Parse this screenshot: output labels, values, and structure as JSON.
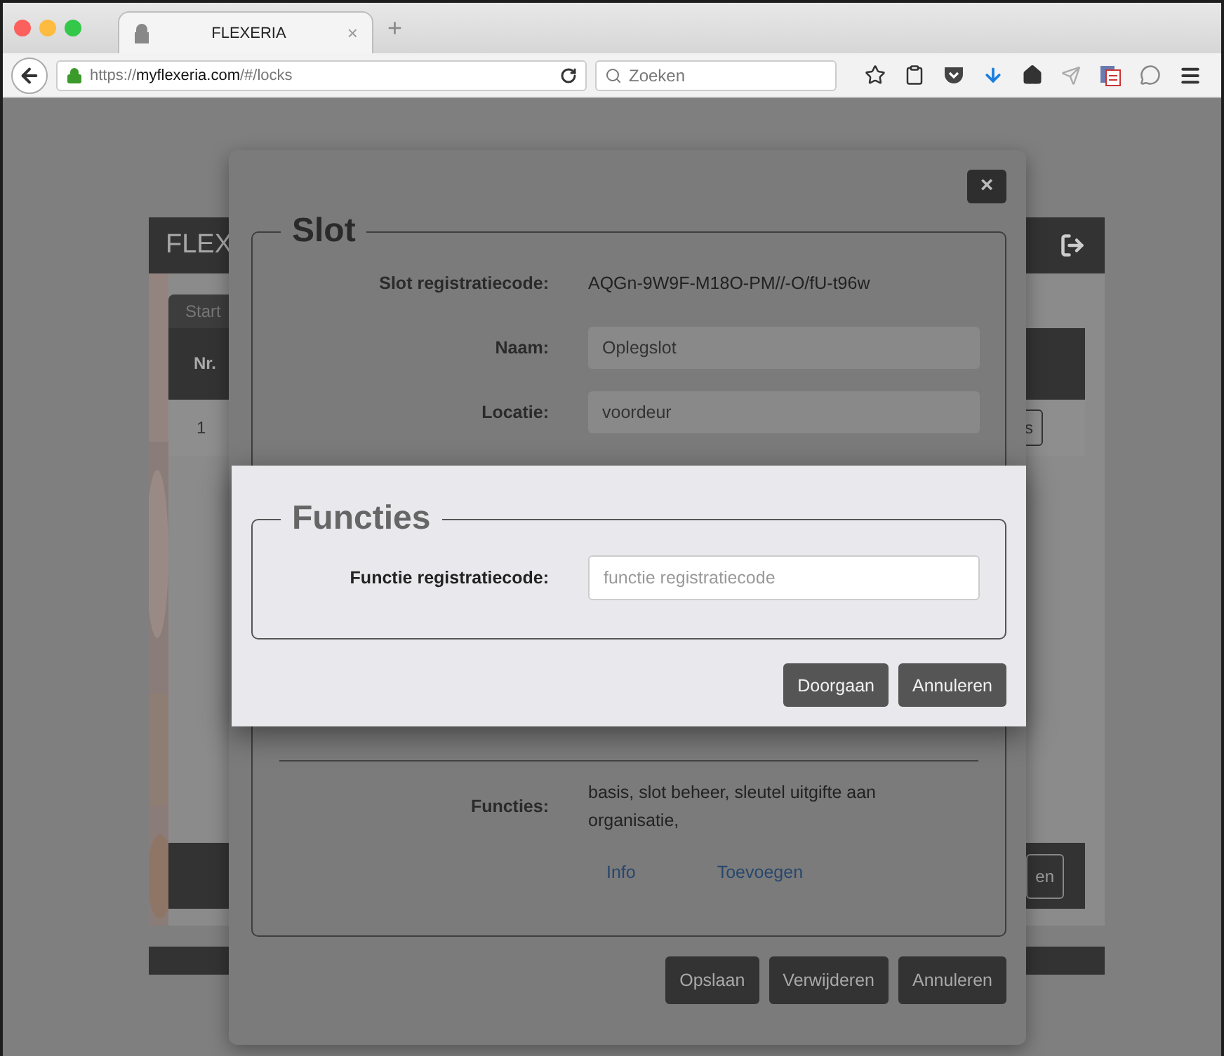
{
  "browser": {
    "tab": {
      "title": "FLEXERIA",
      "close": "×"
    },
    "new_tab": "+",
    "url": {
      "scheme": "https://",
      "host": "myflexeria.com",
      "path": "/#/locks"
    },
    "search": {
      "placeholder": "Zoeken"
    }
  },
  "background_app": {
    "brand": "FLEX",
    "tab": "Start",
    "column": "Nr.",
    "row_number": "1",
    "row_button": "s",
    "footer_button": "en"
  },
  "slot_dialog": {
    "close": "×",
    "legend": "Slot",
    "fields": [
      {
        "kind": "text",
        "label": "Slot registratiecode:",
        "value": "AQGn-9W9F-M18O-PM//-O/fU-t96w"
      },
      {
        "kind": "input",
        "label": "Naam:",
        "value": "Oplegslot"
      },
      {
        "kind": "input",
        "label": "Locatie:",
        "value": "voordeur"
      }
    ],
    "functies": {
      "label": "Functies:",
      "value": "basis, slot beheer, sleutel uitgifte aan organisatie,"
    },
    "links": [
      "Info",
      "Toevoegen"
    ],
    "buttons": [
      "Opslaan",
      "Verwijderen",
      "Annuleren"
    ]
  },
  "functies_dialog": {
    "legend": "Functies",
    "field": {
      "label": "Functie registratiecode:",
      "placeholder": "functie registratiecode"
    },
    "buttons": [
      "Doorgaan",
      "Annuleren"
    ]
  }
}
